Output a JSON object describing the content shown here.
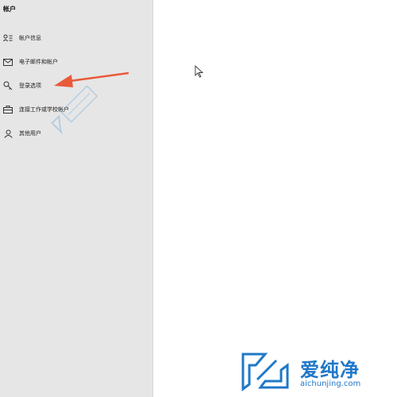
{
  "sidebar": {
    "section_title": "帐户",
    "items": [
      {
        "label": "帐户信息",
        "icon": "account-info-icon"
      },
      {
        "label": "电子邮件和帐户",
        "icon": "email-icon"
      },
      {
        "label": "登录选项",
        "icon": "key-icon"
      },
      {
        "label": "连接工作或学校帐户",
        "icon": "briefcase-icon"
      },
      {
        "label": "其他用户",
        "icon": "user-icon"
      }
    ]
  },
  "annotation": {
    "arrow_color": "#e85a3a",
    "target": "登录选项"
  },
  "watermark": {
    "brand": "爱纯净",
    "url": "aichunjing.com",
    "color": "#1f78c8"
  }
}
